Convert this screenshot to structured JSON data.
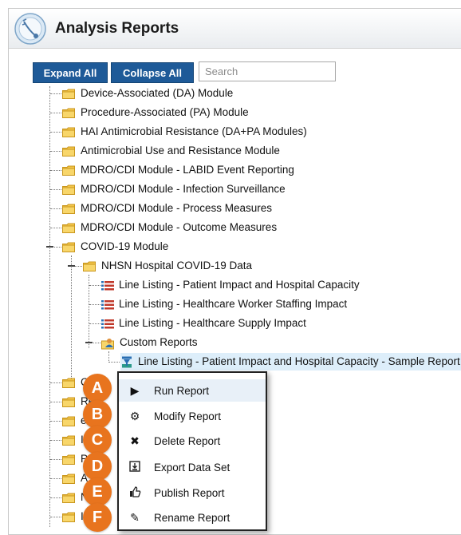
{
  "header": {
    "title": "Analysis Reports"
  },
  "toolbar": {
    "expand_all": "Expand All",
    "collapse_all": "Collapse All",
    "search_placeholder": "Search"
  },
  "tree": {
    "top_folders": [
      "Device-Associated (DA) Module",
      "Procedure-Associated (PA) Module",
      "HAI Antimicrobial Resistance (DA+PA Modules)",
      "Antimicrobial Use and Resistance Module",
      "MDRO/CDI Module - LABID Event Reporting",
      "MDRO/CDI Module - Infection Surveillance",
      "MDRO/CDI Module - Process Measures",
      "MDRO/CDI Module - Outcome Measures",
      "COVID-19 Module"
    ],
    "covid_subfolder": "NHSN Hospital COVID-19 Data",
    "line_listings": [
      "Line Listing - Patient Impact and Hospital Capacity",
      "Line Listing - Healthcare Worker Staffing Impact",
      "Line Listing - Healthcare Supply Impact"
    ],
    "custom_reports": "Custom Reports",
    "selected_report": "Line Listing - Patient Impact and Hospital Capacity - Sample Report",
    "partial_labels": [
      "C",
      "Re",
      "e",
      "I",
      "P",
      "A",
      "N",
      "I"
    ]
  },
  "context_menu": {
    "items": [
      {
        "label": "Run Report",
        "icon": "play-icon",
        "badge": "A"
      },
      {
        "label": "Modify Report",
        "icon": "gear-icon",
        "badge": "B"
      },
      {
        "label": "Delete Report",
        "icon": "x-icon",
        "badge": "C"
      },
      {
        "label": "Export Data Set",
        "icon": "export-icon",
        "badge": "D"
      },
      {
        "label": "Publish Report",
        "icon": "thumbs-up-icon",
        "badge": "E"
      },
      {
        "label": "Rename Report",
        "icon": "pencil-icon",
        "badge": "F"
      }
    ]
  },
  "colors": {
    "button_blue": "#1e5a98",
    "badge_orange": "#e8741e",
    "folder_yellow": "#f3c64a",
    "selection": "#ddeefa"
  }
}
